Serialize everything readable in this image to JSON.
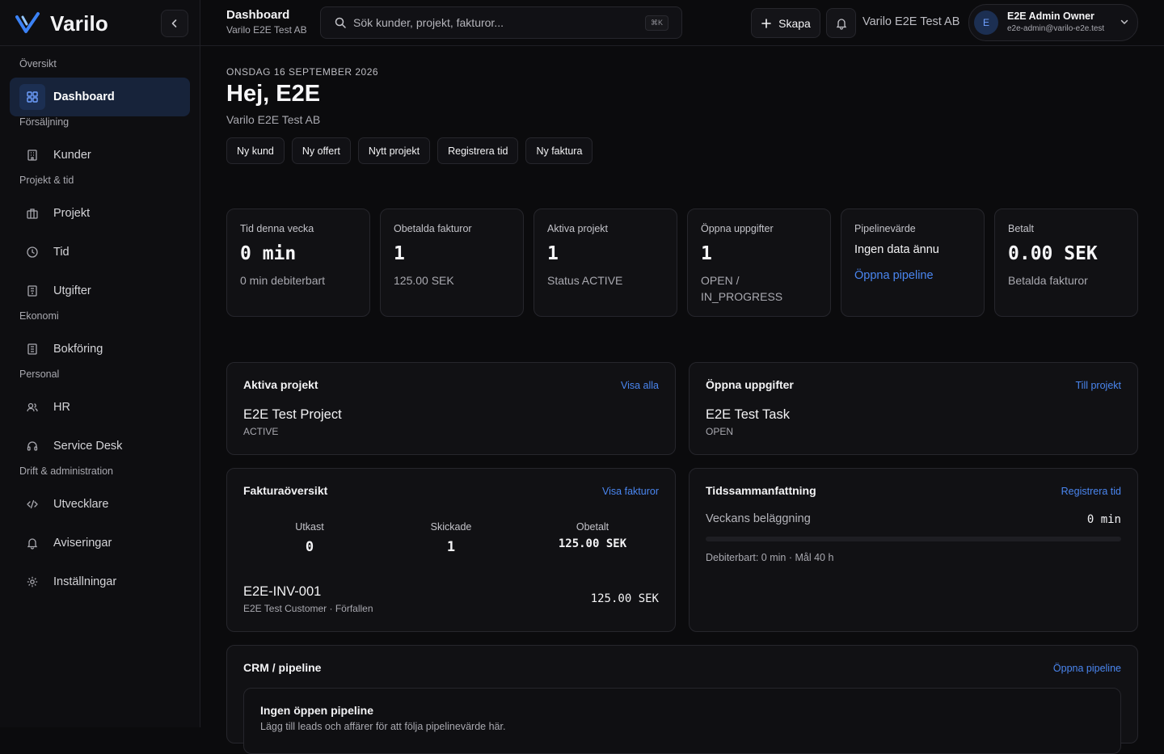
{
  "brand": {
    "name": "Varilo"
  },
  "sidebar": {
    "sections": [
      {
        "label": "Översikt"
      },
      {
        "label": "Försäljning"
      },
      {
        "label": "Projekt & tid"
      },
      {
        "label": "Ekonomi"
      },
      {
        "label": "Personal"
      },
      {
        "label": "Drift & administration"
      }
    ],
    "items": [
      {
        "label": "Dashboard",
        "icon": "grid-icon",
        "active": true
      },
      {
        "label": "Kunder",
        "icon": "building-icon"
      },
      {
        "label": "Projekt",
        "icon": "briefcase-icon"
      },
      {
        "label": "Tid",
        "icon": "clock-icon"
      },
      {
        "label": "Utgifter",
        "icon": "receipt-icon"
      },
      {
        "label": "Bokföring",
        "icon": "ledger-icon"
      },
      {
        "label": "HR",
        "icon": "users-icon"
      },
      {
        "label": "Service Desk",
        "icon": "headset-icon"
      },
      {
        "label": "Utvecklare",
        "icon": "code-icon"
      },
      {
        "label": "Aviseringar",
        "icon": "bell-icon"
      },
      {
        "label": "Inställningar",
        "icon": "gear-icon"
      }
    ]
  },
  "topbar": {
    "title": "Dashboard",
    "subtitle": "Varilo E2E Test AB",
    "search_placeholder": "Sök kunder, projekt, fakturor...",
    "shortcut": "⌘K",
    "create_label": "Skapa",
    "org": "Varilo E2E Test AB",
    "user": {
      "initial": "E",
      "name": "E2E Admin Owner",
      "email": "e2e-admin@varilo-e2e.test"
    }
  },
  "header": {
    "date": "ONSDAG 16 SEPTEMBER 2026",
    "greeting": "Hej, E2E",
    "org": "Varilo E2E Test AB",
    "quick_actions": [
      "Ny kund",
      "Ny offert",
      "Nytt projekt",
      "Registrera tid",
      "Ny faktura"
    ]
  },
  "kpis": [
    {
      "label": "Tid denna vecka",
      "value": "0 min",
      "sub": "0 min debiterbart"
    },
    {
      "label": "Obetalda fakturor",
      "value": "1",
      "sub": "125.00 SEK"
    },
    {
      "label": "Aktiva projekt",
      "value": "1",
      "sub": "Status ACTIVE"
    },
    {
      "label": "Öppna uppgifter",
      "value": "1",
      "sub": "OPEN / IN_PROGRESS"
    },
    {
      "label": "Pipelinevärde",
      "text": "Ingen data ännu",
      "link": "Öppna pipeline"
    },
    {
      "label": "Betalt",
      "value": "0.00 SEK",
      "sub": "Betalda fakturor"
    }
  ],
  "active_projects": {
    "title": "Aktiva projekt",
    "link": "Visa alla",
    "item": {
      "name": "E2E Test Project",
      "status": "ACTIVE"
    }
  },
  "open_tasks": {
    "title": "Öppna uppgifter",
    "link": "Till projekt",
    "item": {
      "name": "E2E Test Task",
      "status": "OPEN"
    }
  },
  "invoices": {
    "title": "Fakturaöversikt",
    "link": "Visa fakturor",
    "stats": [
      {
        "label": "Utkast",
        "value": "0"
      },
      {
        "label": "Skickade",
        "value": "1"
      },
      {
        "label": "Obetalt",
        "value": "125.00 SEK"
      }
    ],
    "row": {
      "number": "E2E-INV-001",
      "meta": "E2E Test Customer · Förfallen",
      "amount": "125.00 SEK"
    }
  },
  "time_summary": {
    "title": "Tidssammanfattning",
    "link": "Registrera tid",
    "label": "Veckans beläggning",
    "value": "0 min",
    "progress": 0,
    "footer": "Debiterbart: 0 min · Mål 40 h"
  },
  "crm": {
    "title": "CRM / pipeline",
    "link": "Öppna pipeline",
    "empty_title": "Ingen öppen pipeline",
    "empty_text": "Lägg till leads och affärer för att följa pipelinevärde här."
  },
  "colors": {
    "accent": "#4a86f0",
    "background": "#0b0b0d",
    "card": "#111114",
    "active_nav": "#17233a"
  }
}
